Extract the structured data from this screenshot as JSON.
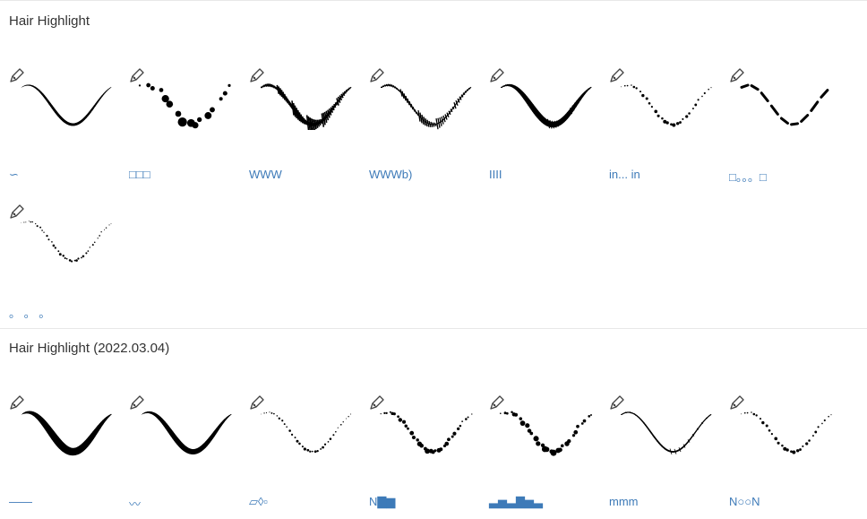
{
  "sections": [
    {
      "title": "Hair Highlight",
      "brushes": [
        {
          "label": "∽",
          "style": "thin-taper"
        },
        {
          "label": "□□□",
          "style": "blotch"
        },
        {
          "label": "WWW",
          "style": "rough-thick"
        },
        {
          "label": "WWWb)",
          "style": "rough-medium"
        },
        {
          "label": "IIII",
          "style": "fur-thick"
        },
        {
          "label": "in... in",
          "style": "dotted-fine"
        },
        {
          "label": "□。。。□",
          "style": "dashed"
        },
        {
          "label": "。 。 。",
          "style": "dotted-sparse"
        }
      ]
    },
    {
      "title": "Hair Highlight (2022.03.04)",
      "brushes": [
        {
          "label": "——",
          "style": "thick-smooth"
        },
        {
          "label": "〰",
          "style": "medium-smooth"
        },
        {
          "label": "▱◊▫",
          "style": "thin-dotted"
        },
        {
          "label": "N▇▆",
          "style": "dotted-medium"
        },
        {
          "label": "▃▅▃▇▅▃",
          "style": "blotch-medium"
        },
        {
          "label": "mmm",
          "style": "fine-taper"
        },
        {
          "label": "N○○N",
          "style": "dotted-fine"
        }
      ]
    }
  ]
}
